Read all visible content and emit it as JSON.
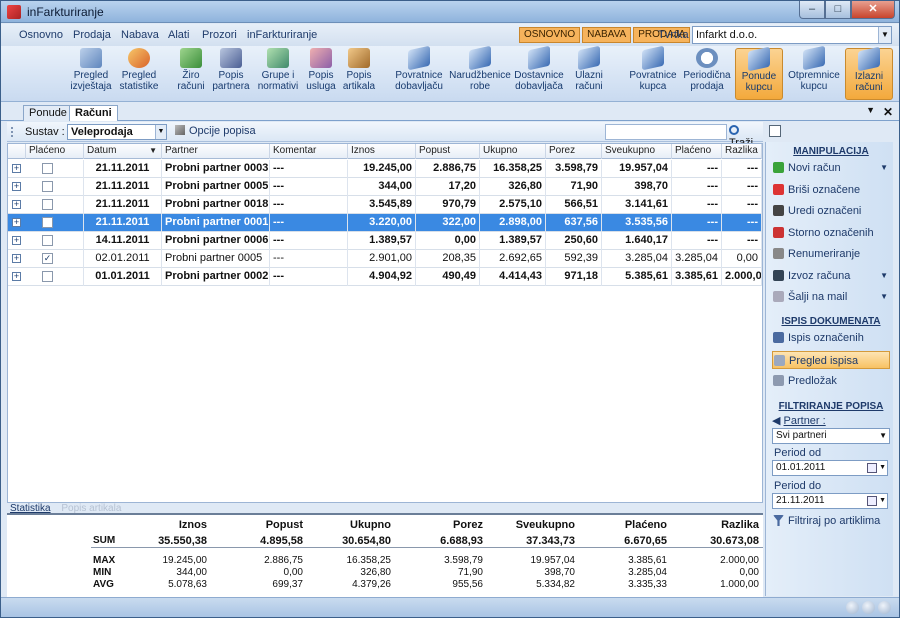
{
  "window": {
    "title": "inFarkturiranje",
    "min": "–",
    "max": "□",
    "close": "✕"
  },
  "menu": [
    "Osnovno",
    "Prodaja",
    "Nabava",
    "Alati",
    "Prozori",
    "inFarkturiranje"
  ],
  "context_tabs": [
    "OSNOVNO",
    "NABAVA",
    "PRODAJA"
  ],
  "tvrtka": {
    "label": "Tvrtka :",
    "value": "Infarkt d.o.o."
  },
  "ribbon": [
    {
      "l1": "Pregled",
      "l2": "izvještaja",
      "icon": "report-icon"
    },
    {
      "l1": "Pregled",
      "l2": "statistike",
      "icon": "chart-icon"
    },
    {
      "l1": "Žiro",
      "l2": "računi",
      "icon": "bank-icon"
    },
    {
      "l1": "Popis",
      "l2": "partnera",
      "icon": "partners-icon"
    },
    {
      "l1": "Grupe i",
      "l2": "normativi",
      "icon": "groups-icon"
    },
    {
      "l1": "Popis",
      "l2": "usluga",
      "icon": "services-icon"
    },
    {
      "l1": "Popis",
      "l2": "artikala",
      "icon": "articles-icon"
    },
    {
      "l1": "Povratnice",
      "l2": "dobavljaču",
      "icon": "document-icon"
    },
    {
      "l1": "Narudžbenice",
      "l2": "robe",
      "icon": "document-icon"
    },
    {
      "l1": "Dostavnice",
      "l2": "dobavljača",
      "icon": "document-icon"
    },
    {
      "l1": "Ulazni",
      "l2": "računi",
      "icon": "document-icon"
    },
    {
      "l1": "Povratnice",
      "l2": "kupca",
      "icon": "document-icon"
    },
    {
      "l1": "Periodična",
      "l2": "prodaja",
      "icon": "clock-icon"
    },
    {
      "l1": "Ponude",
      "l2": "kupcu",
      "icon": "document-icon"
    },
    {
      "l1": "Otpremnice",
      "l2": "kupcu",
      "icon": "document-icon"
    },
    {
      "l1": "Izlazni",
      "l2": "računi",
      "icon": "document-icon"
    }
  ],
  "doc_tabs": [
    "Ponude",
    "Računi"
  ],
  "toolbar": {
    "sustav_label": "Sustav :",
    "sustav_value": "Veleprodaja",
    "opcije": "Opcije popisa",
    "search_value": "",
    "trazi": "Traži"
  },
  "columns": [
    "Plaćeno",
    "Datum",
    "Partner",
    "Komentar",
    "Iznos",
    "Popust",
    "Ukupno",
    "Porez",
    "Sveukupno",
    "Plaćeno",
    "Razlika"
  ],
  "rows": [
    {
      "checked": false,
      "bold": true,
      "selected": false,
      "datum": "21.11.2011",
      "partner": "Probni partner 0003",
      "komentar": "---",
      "iznos": "19.245,00",
      "popust": "2.886,75",
      "ukupno": "16.358,25",
      "porez": "3.598,79",
      "sveukupno": "19.957,04",
      "placeno": "---",
      "razlika": "---"
    },
    {
      "checked": false,
      "bold": true,
      "selected": false,
      "datum": "21.11.2011",
      "partner": "Probni partner 0005",
      "komentar": "---",
      "iznos": "344,00",
      "popust": "17,20",
      "ukupno": "326,80",
      "porez": "71,90",
      "sveukupno": "398,70",
      "placeno": "---",
      "razlika": "---"
    },
    {
      "checked": false,
      "bold": true,
      "selected": false,
      "datum": "21.11.2011",
      "partner": "Probni partner 0018",
      "komentar": "---",
      "iznos": "3.545,89",
      "popust": "970,79",
      "ukupno": "2.575,10",
      "porez": "566,51",
      "sveukupno": "3.141,61",
      "placeno": "---",
      "razlika": "---"
    },
    {
      "checked": false,
      "bold": true,
      "selected": true,
      "datum": "21.11.2011",
      "partner": "Probni partner 0001",
      "komentar": "---",
      "iznos": "3.220,00",
      "popust": "322,00",
      "ukupno": "2.898,00",
      "porez": "637,56",
      "sveukupno": "3.535,56",
      "placeno": "---",
      "razlika": "---"
    },
    {
      "checked": false,
      "bold": true,
      "selected": false,
      "datum": "14.11.2011",
      "partner": "Probni partner 0006",
      "komentar": "---",
      "iznos": "1.389,57",
      "popust": "0,00",
      "ukupno": "1.389,57",
      "porez": "250,60",
      "sveukupno": "1.640,17",
      "placeno": "---",
      "razlika": "---"
    },
    {
      "checked": true,
      "bold": false,
      "selected": false,
      "datum": "02.01.2011",
      "partner": "Probni partner 0005",
      "komentar": "---",
      "iznos": "2.901,00",
      "popust": "208,35",
      "ukupno": "2.692,65",
      "porez": "592,39",
      "sveukupno": "3.285,04",
      "placeno": "3.285,04",
      "razlika": "0,00"
    },
    {
      "checked": false,
      "bold": true,
      "selected": false,
      "datum": "01.01.2011",
      "partner": "Probni partner 0002",
      "komentar": "---",
      "iznos": "4.904,92",
      "popust": "490,49",
      "ukupno": "4.414,43",
      "porez": "971,18",
      "sveukupno": "5.385,61",
      "placeno": "3.385,61",
      "razlika": "2.000,00"
    }
  ],
  "bottom_tabs": [
    "Statistika",
    "Popis artikala"
  ],
  "stats": {
    "headers": [
      "Iznos",
      "Popust",
      "Ukupno",
      "Porez",
      "Sveukupno",
      "Plaćeno",
      "Razlika"
    ],
    "rows": [
      {
        "label": "SUM",
        "values": [
          "35.550,38",
          "4.895,58",
          "30.654,80",
          "6.688,93",
          "37.343,73",
          "6.670,65",
          "30.673,08"
        ]
      },
      {
        "label": "MAX",
        "values": [
          "19.245,00",
          "2.886,75",
          "16.358,25",
          "3.598,79",
          "19.957,04",
          "3.385,61",
          "2.000,00"
        ]
      },
      {
        "label": "MIN",
        "values": [
          "344,00",
          "0,00",
          "326,80",
          "71,90",
          "398,70",
          "3.285,04",
          "0,00"
        ]
      },
      {
        "label": "AVG",
        "values": [
          "5.078,63",
          "699,37",
          "4.379,26",
          "955,56",
          "5.334,82",
          "3.335,33",
          "1.000,00"
        ]
      }
    ]
  },
  "side": {
    "manip_title": "MANIPULACIJA",
    "manip": [
      {
        "label": "Novi račun",
        "icon": "plus-icon",
        "arrow": true
      },
      {
        "label": "Briši označene",
        "icon": "delete-icon",
        "arrow": false
      },
      {
        "label": "Uredi označeni",
        "icon": "edit-icon",
        "arrow": false
      },
      {
        "label": "Storno označenih",
        "icon": "storno-icon",
        "arrow": false
      },
      {
        "label": "Renumeriranje",
        "icon": "renumber-icon",
        "arrow": false
      },
      {
        "label": "Izvoz računa",
        "icon": "export-icon",
        "arrow": true
      },
      {
        "label": "Šalji na mail",
        "icon": "mail-icon",
        "arrow": true
      }
    ],
    "ispis_title": "ISPIS DOKUMENATA",
    "ispis": [
      {
        "label": "Ispis označenih",
        "icon": "print-icon"
      },
      {
        "label": "Pregled ispisa",
        "icon": "preview-icon"
      },
      {
        "label": "Predložak",
        "icon": "template-icon"
      }
    ],
    "filter_title": "FILTRIRANJE POPISA",
    "partner_label": "Partner :",
    "partner_value": "Svi partneri",
    "period_od_label": "Period od",
    "period_od": "01.01.2011",
    "period_do_label": "Period do",
    "period_do": "21.11.2011",
    "filter_art": "Filtriraj po artiklima"
  },
  "colors": {
    "accent": "#3a89e2",
    "ribbon_active": "#f3a93c",
    "title": "#8fb3dc"
  }
}
